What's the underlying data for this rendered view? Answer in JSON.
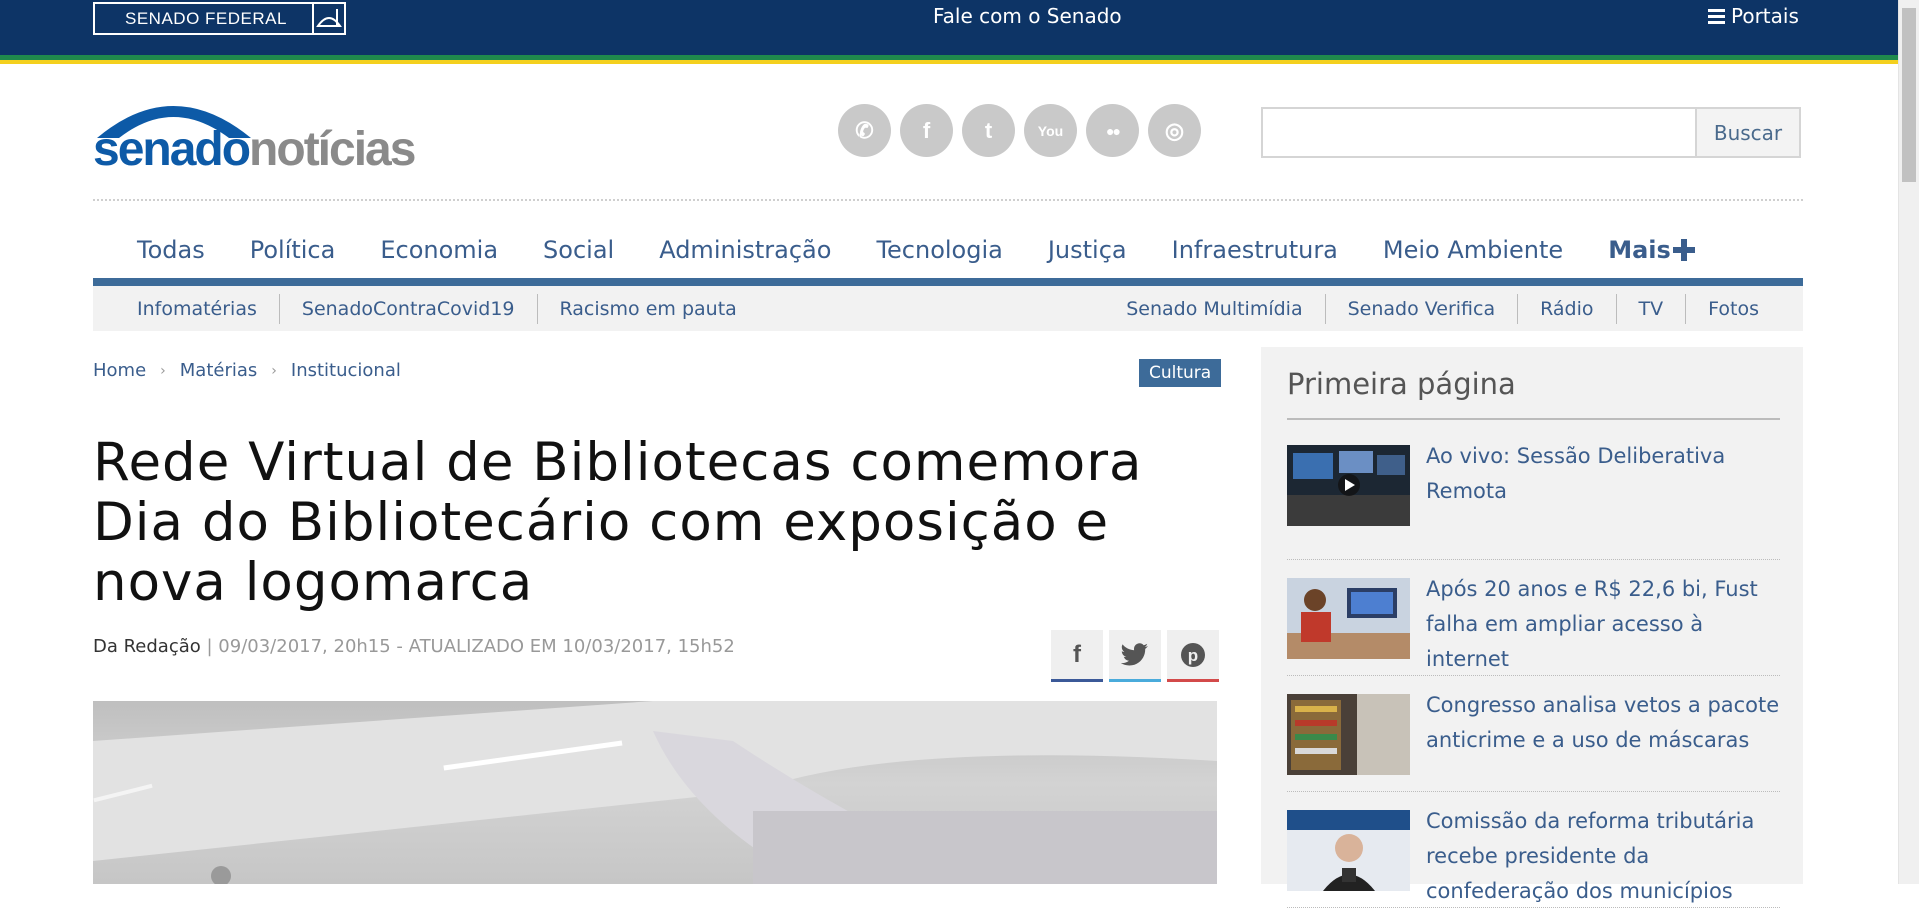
{
  "topbar": {
    "senado_label": "SENADO FEDERAL",
    "fale_label": "Fale com o Senado",
    "portais_label": "Portais"
  },
  "logo": {
    "part1": "senado",
    "part2": "notícias"
  },
  "social": [
    {
      "name": "whatsapp-icon",
      "glyph": "✆"
    },
    {
      "name": "facebook-icon",
      "glyph": "f"
    },
    {
      "name": "twitter-icon",
      "glyph": "t"
    },
    {
      "name": "youtube-icon",
      "glyph": "You"
    },
    {
      "name": "flickr-icon",
      "glyph": "●●"
    },
    {
      "name": "instagram-icon",
      "glyph": "◎"
    }
  ],
  "search": {
    "value": "",
    "button_label": "Buscar"
  },
  "main_nav": {
    "items": [
      "Todas",
      "Política",
      "Economia",
      "Social",
      "Administração",
      "Tecnologia",
      "Justiça",
      "Infraestrutura",
      "Meio Ambiente"
    ],
    "mais_label": "Mais"
  },
  "sub_nav": {
    "left": [
      "Infomatérias",
      "SenadoContraCovid19",
      "Racismo em pauta"
    ],
    "right": [
      "Senado Multimídia",
      "Senado Verifica",
      "Rádio",
      "TV",
      "Fotos"
    ]
  },
  "breadcrumb": [
    "Home",
    "Matérias",
    "Institucional"
  ],
  "tag": "Cultura",
  "article": {
    "title": "Rede Virtual de Bibliotecas comemora Dia do Bibliotecário com exposição e nova logomarca",
    "author": "Da Redação",
    "date": "| 09/03/2017, 20h15 - ATUALIZADO EM 10/03/2017, 15h52"
  },
  "share": [
    "facebook-share",
    "twitter-share",
    "pinterest-share"
  ],
  "sidebar": {
    "heading": "Primeira página",
    "items": [
      {
        "title": "Ao vivo: Sessão Deliberativa Remota"
      },
      {
        "title": "Após 20 anos e R$ 22,6 bi, Fust falha em ampliar acesso à internet"
      },
      {
        "title": "Congresso analisa vetos a pacote anticrime e a uso de máscaras"
      },
      {
        "title": "Comissão da reforma tributária recebe presidente da confederação dos municípios"
      }
    ]
  },
  "colors": {
    "topbar": "#0d3466",
    "link": "#3a5d8c",
    "accent": "#3d6b99"
  }
}
